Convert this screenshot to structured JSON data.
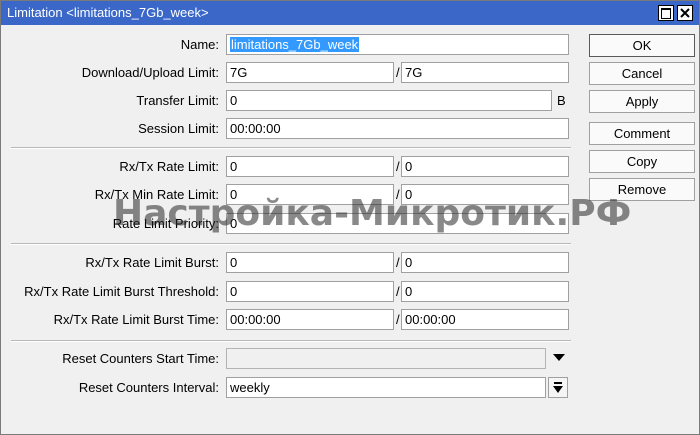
{
  "window": {
    "title": "Limitation <limitations_7Gb_week>"
  },
  "form": {
    "name": {
      "label": "Name:",
      "value": "limitations_7Gb_week"
    },
    "download_upload_limit": {
      "label": "Download/Upload Limit:",
      "rx": "7G",
      "tx": "7G"
    },
    "transfer_limit": {
      "label": "Transfer Limit:",
      "value": "0",
      "unit": "B"
    },
    "session_limit": {
      "label": "Session Limit:",
      "value": "00:00:00"
    },
    "rate_limit": {
      "label": "Rx/Tx Rate Limit:",
      "rx": "0",
      "tx": "0"
    },
    "min_rate_limit": {
      "label": "Rx/Tx Min Rate Limit:",
      "rx": "0",
      "tx": "0"
    },
    "rate_limit_priority": {
      "label": "Rate Limit Priority:",
      "value": "0"
    },
    "rate_limit_burst": {
      "label": "Rx/Tx Rate Limit Burst:",
      "rx": "0",
      "tx": "0"
    },
    "rate_limit_burst_threshold": {
      "label": "Rx/Tx Rate Limit Burst Threshold:",
      "rx": "0",
      "tx": "0"
    },
    "rate_limit_burst_time": {
      "label": "Rx/Tx Rate Limit Burst Time:",
      "rx": "00:00:00",
      "tx": "00:00:00"
    },
    "reset_counters_start_time": {
      "label": "Reset Counters Start Time:",
      "value": ""
    },
    "reset_counters_interval": {
      "label": "Reset Counters Interval:",
      "value": "weekly"
    },
    "separator": "/"
  },
  "buttons": {
    "ok": "OK",
    "cancel": "Cancel",
    "apply": "Apply",
    "comment": "Comment",
    "copy": "Copy",
    "remove": "Remove"
  },
  "watermark": "Настройка-Микротик.РФ",
  "colors": {
    "titlebar": "#3b67c8",
    "selection": "#3399ff",
    "window_bg": "#f0f0f0"
  }
}
